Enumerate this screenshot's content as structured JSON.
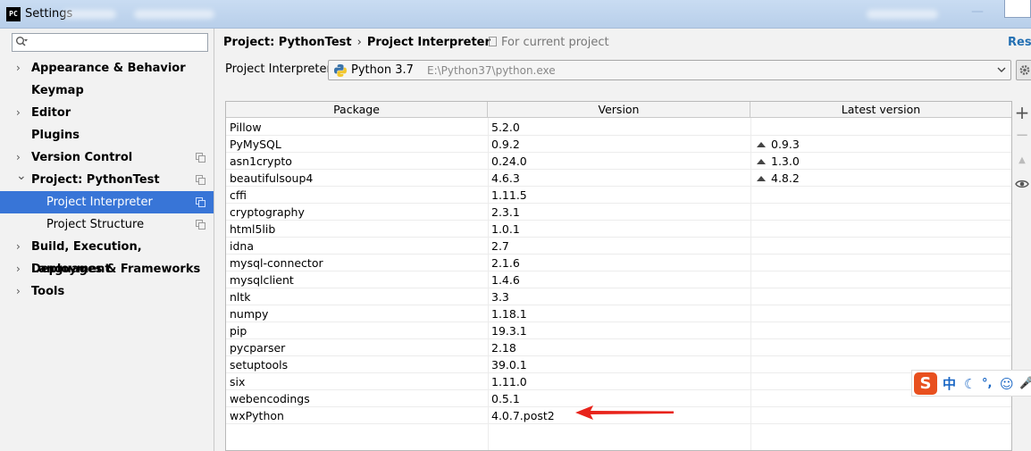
{
  "window": {
    "title": "Settings",
    "app_icon_label": "PC"
  },
  "sidebar": {
    "search": {
      "value": "",
      "placeholder": ""
    },
    "items": [
      {
        "label": "Appearance & Behavior",
        "expandable": true,
        "expanded": false,
        "level": 0
      },
      {
        "label": "Keymap",
        "expandable": false,
        "level": 0
      },
      {
        "label": "Editor",
        "expandable": true,
        "expanded": false,
        "level": 0
      },
      {
        "label": "Plugins",
        "expandable": false,
        "level": 0
      },
      {
        "label": "Version Control",
        "expandable": true,
        "expanded": false,
        "level": 0,
        "project_icon": true
      },
      {
        "label": "Project: PythonTest",
        "expandable": true,
        "expanded": true,
        "level": 0,
        "project_icon": true
      },
      {
        "label": "Project Interpreter",
        "expandable": false,
        "level": 1,
        "selected": true,
        "project_icon": true
      },
      {
        "label": "Project Structure",
        "expandable": false,
        "level": 1,
        "project_icon": true
      },
      {
        "label": "Build, Execution, Deployment",
        "expandable": true,
        "expanded": false,
        "level": 0
      },
      {
        "label": "Languages & Frameworks",
        "expandable": true,
        "expanded": false,
        "level": 0
      },
      {
        "label": "Tools",
        "expandable": true,
        "expanded": false,
        "level": 0
      }
    ]
  },
  "header": {
    "breadcrumb": [
      "Project: PythonTest",
      "Project Interpreter"
    ],
    "breadcrumb_separator": "›",
    "scope_label": "For current project",
    "reset_label": "Rese"
  },
  "interpreter": {
    "label": "Project Interpreter:",
    "name": "Python 3.7",
    "path": "E:\\Python37\\python.exe"
  },
  "packages_table": {
    "columns": [
      "Package",
      "Version",
      "Latest version"
    ],
    "rows": [
      {
        "package": "Pillow",
        "version": "5.2.0",
        "latest": ""
      },
      {
        "package": "PyMySQL",
        "version": "0.9.2",
        "latest": "0.9.3"
      },
      {
        "package": "asn1crypto",
        "version": "0.24.0",
        "latest": "1.3.0"
      },
      {
        "package": "beautifulsoup4",
        "version": "4.6.3",
        "latest": "4.8.2"
      },
      {
        "package": "cffi",
        "version": "1.11.5",
        "latest": ""
      },
      {
        "package": "cryptography",
        "version": "2.3.1",
        "latest": ""
      },
      {
        "package": "html5lib",
        "version": "1.0.1",
        "latest": ""
      },
      {
        "package": "idna",
        "version": "2.7",
        "latest": ""
      },
      {
        "package": "mysql-connector",
        "version": "2.1.6",
        "latest": ""
      },
      {
        "package": "mysqlclient",
        "version": "1.4.6",
        "latest": ""
      },
      {
        "package": "nltk",
        "version": "3.3",
        "latest": ""
      },
      {
        "package": "numpy",
        "version": "1.18.1",
        "latest": ""
      },
      {
        "package": "pip",
        "version": "19.3.1",
        "latest": ""
      },
      {
        "package": "pycparser",
        "version": "2.18",
        "latest": ""
      },
      {
        "package": "setuptools",
        "version": "39.0.1",
        "latest": ""
      },
      {
        "package": "six",
        "version": "1.11.0",
        "latest": ""
      },
      {
        "package": "webencodings",
        "version": "0.5.1",
        "latest": ""
      },
      {
        "package": "wxPython",
        "version": "4.0.7.post2",
        "latest": ""
      }
    ]
  },
  "toolbar": {
    "add_symbol": "+",
    "remove_symbol": "−",
    "upgrade_symbol": "▲"
  },
  "ime": {
    "logo": "S",
    "items": [
      "中",
      "☾",
      "°,",
      "☺",
      "🎤"
    ]
  },
  "colors": {
    "selection": "#3875d7",
    "link": "#2470b3",
    "annotation_arrow": "#e8231b",
    "ime_logo": "#e8501f"
  },
  "icons": {
    "search": "search-icon",
    "python": "python-icon",
    "gear": "gear-icon",
    "eye": "eye-icon",
    "copy": "copy-icon"
  }
}
